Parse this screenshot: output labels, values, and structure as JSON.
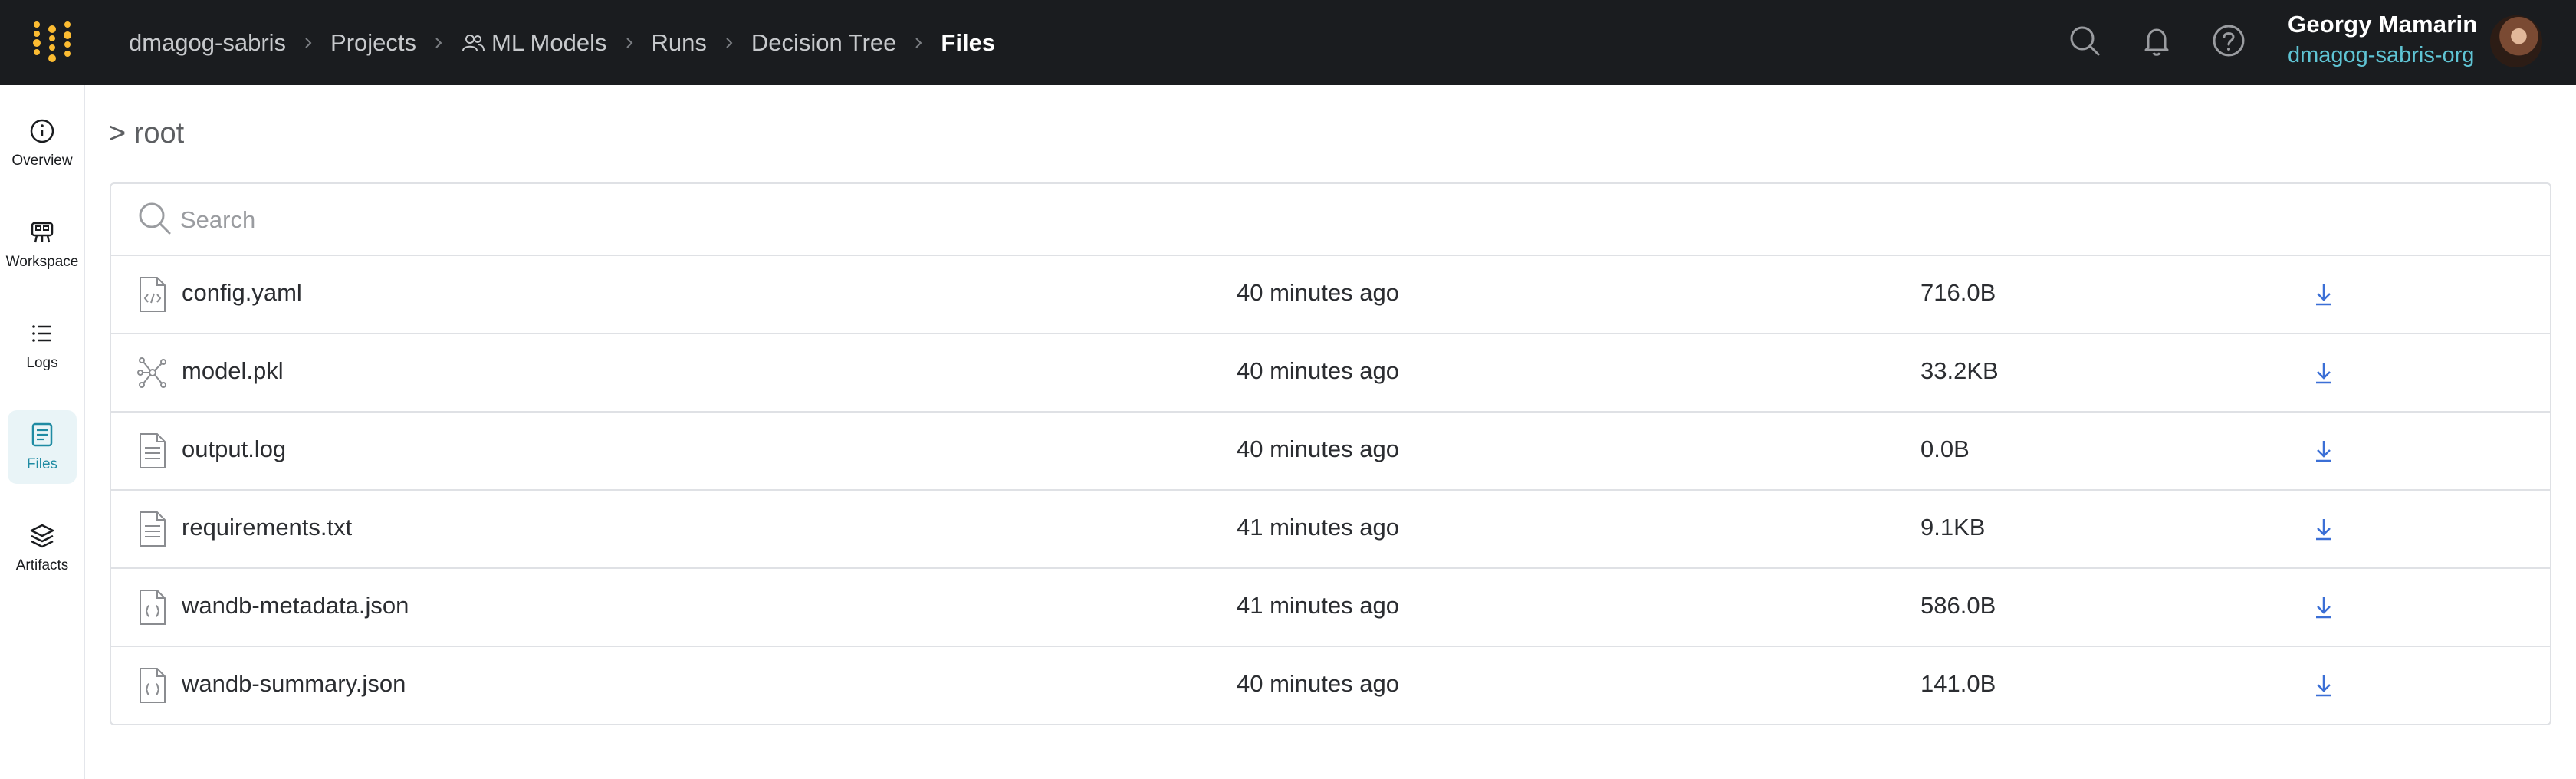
{
  "header": {
    "breadcrumbs": [
      "dmagog-sabris",
      "Projects",
      "ML Models",
      "Runs",
      "Decision Tree",
      "Files"
    ],
    "user_name": "Georgy Mamarin",
    "user_org": "dmagog-sabris-org",
    "icons": [
      "search-icon",
      "bell-icon",
      "help-icon"
    ]
  },
  "sidebar": {
    "items": [
      {
        "label": "Overview",
        "icon": "info-icon"
      },
      {
        "label": "Workspace",
        "icon": "workspace-icon"
      },
      {
        "label": "Logs",
        "icon": "list-icon"
      },
      {
        "label": "Files",
        "icon": "file-icon"
      },
      {
        "label": "Artifacts",
        "icon": "layers-icon"
      }
    ],
    "active": "Files"
  },
  "main": {
    "path_title": "> root",
    "search": {
      "placeholder": "Search",
      "value": ""
    },
    "files": [
      {
        "name": "config.yaml",
        "modified": "40 minutes ago",
        "size": "716.0B",
        "icon": "code-file-icon"
      },
      {
        "name": "model.pkl",
        "modified": "40 minutes ago",
        "size": "33.2KB",
        "icon": "model-graph-icon"
      },
      {
        "name": "output.log",
        "modified": "40 minutes ago",
        "size": "0.0B",
        "icon": "text-file-icon"
      },
      {
        "name": "requirements.txt",
        "modified": "41 minutes ago",
        "size": "9.1KB",
        "icon": "text-file-icon"
      },
      {
        "name": "wandb-metadata.json",
        "modified": "41 minutes ago",
        "size": "586.0B",
        "icon": "json-file-icon"
      },
      {
        "name": "wandb-summary.json",
        "modified": "40 minutes ago",
        "size": "141.0B",
        "icon": "json-file-icon"
      }
    ]
  },
  "colors": {
    "topbar_bg": "#1a1c1f",
    "accent": "#1f8ba3",
    "org_link": "#5fc4d4",
    "logo": "#fcbc32",
    "download_icon": "#3b6fd6"
  }
}
